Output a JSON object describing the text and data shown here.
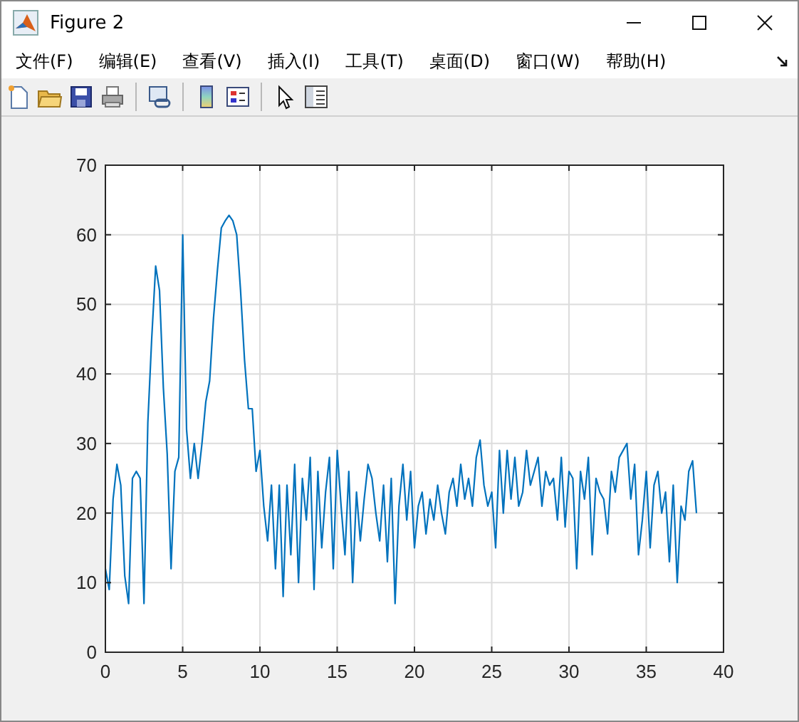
{
  "window": {
    "title": "Figure 2"
  },
  "menu": [
    "文件(F)",
    "编辑(E)",
    "查看(V)",
    "插入(I)",
    "工具(T)",
    "桌面(D)",
    "窗口(W)",
    "帮助(H)"
  ],
  "toolbar": [
    {
      "kind": "new"
    },
    {
      "kind": "open"
    },
    {
      "kind": "save"
    },
    {
      "kind": "print"
    },
    {
      "kind": "separator"
    },
    {
      "kind": "link"
    },
    {
      "kind": "separator"
    },
    {
      "kind": "colorbar"
    },
    {
      "kind": "legend"
    },
    {
      "kind": "separator"
    },
    {
      "kind": "pointer"
    },
    {
      "kind": "property"
    }
  ],
  "figure": {
    "chart_data": {
      "type": "line",
      "grid": true,
      "xlim": [
        0,
        40
      ],
      "ylim": [
        0,
        70
      ],
      "xticks": [
        0,
        5,
        10,
        15,
        20,
        25,
        30,
        35,
        40
      ],
      "yticks": [
        0,
        10,
        20,
        30,
        40,
        50,
        60,
        70
      ],
      "x": [
        0,
        0.25,
        0.5,
        0.75,
        1,
        1.25,
        1.5,
        1.75,
        2,
        2.25,
        2.5,
        2.75,
        3,
        3.25,
        3.5,
        3.75,
        4,
        4.25,
        4.5,
        4.75,
        5,
        5.25,
        5.5,
        5.75,
        6,
        6.25,
        6.5,
        6.75,
        7,
        7.25,
        7.5,
        7.75,
        8,
        8.25,
        8.5,
        8.75,
        9,
        9.25,
        9.5,
        9.75,
        10,
        10.25,
        10.5,
        10.75,
        11,
        11.25,
        11.5,
        11.75,
        12,
        12.25,
        12.5,
        12.75,
        13,
        13.25,
        13.5,
        13.75,
        14,
        14.25,
        14.5,
        14.75,
        15,
        15.25,
        15.5,
        15.75,
        16,
        16.25,
        16.5,
        16.75,
        17,
        17.25,
        17.5,
        17.75,
        18,
        18.25,
        18.5,
        18.75,
        19,
        19.25,
        19.5,
        19.75,
        20,
        20.25,
        20.5,
        20.75,
        21,
        21.25,
        21.5,
        21.75,
        22,
        22.25,
        22.5,
        22.75,
        23,
        23.25,
        23.5,
        23.75,
        24,
        24.25,
        24.5,
        24.75,
        25,
        25.25,
        25.5,
        25.75,
        26,
        26.25,
        26.5,
        26.75,
        27,
        27.25,
        27.5,
        27.75,
        28,
        28.25,
        28.5,
        28.75,
        29,
        29.25,
        29.5,
        29.75,
        30,
        30.25,
        30.5,
        30.75,
        31,
        31.25,
        31.5,
        31.75,
        32,
        32.25,
        32.5,
        32.75,
        33,
        33.25,
        33.5,
        33.75,
        34,
        34.25,
        34.5,
        34.75,
        35,
        35.25,
        35.5,
        35.75,
        36,
        36.25,
        36.5,
        36.75,
        37,
        37.25,
        37.5,
        37.75,
        38,
        38.25
      ],
      "series": [
        {
          "color": "#0072bd",
          "values": [
            12,
            9,
            22,
            27,
            24,
            11,
            7,
            25,
            26,
            25,
            7,
            33,
            45,
            55.5,
            52,
            38,
            28.5,
            12,
            26,
            28,
            60,
            32,
            25,
            30,
            25,
            30,
            36,
            39,
            48,
            55,
            61,
            62,
            62.8,
            62,
            60,
            52,
            42,
            35,
            35,
            26,
            29,
            21,
            16,
            24,
            12,
            24,
            8,
            24,
            14,
            27,
            10,
            25,
            19,
            28,
            9,
            26,
            15,
            23,
            28,
            12,
            29,
            21,
            14,
            26,
            10,
            23,
            16,
            22,
            27,
            25,
            20,
            16,
            24,
            13,
            25,
            7,
            21,
            27,
            19,
            26,
            15,
            21,
            23,
            17,
            22,
            19,
            24,
            20,
            17,
            23,
            25,
            21,
            27,
            22,
            25,
            21,
            28,
            30.5,
            24,
            21,
            23,
            15,
            29,
            20,
            29,
            22,
            28,
            21,
            23,
            29,
            24,
            26,
            28,
            21,
            26,
            24,
            25,
            19,
            28,
            18,
            26,
            25,
            12,
            26,
            22,
            28,
            14,
            25,
            23,
            22,
            17,
            26,
            23,
            28,
            29,
            30,
            22,
            27,
            14,
            19,
            26,
            15,
            24,
            26,
            20,
            23,
            13,
            24,
            10,
            21,
            19,
            26,
            27.5,
            20
          ]
        }
      ]
    }
  }
}
